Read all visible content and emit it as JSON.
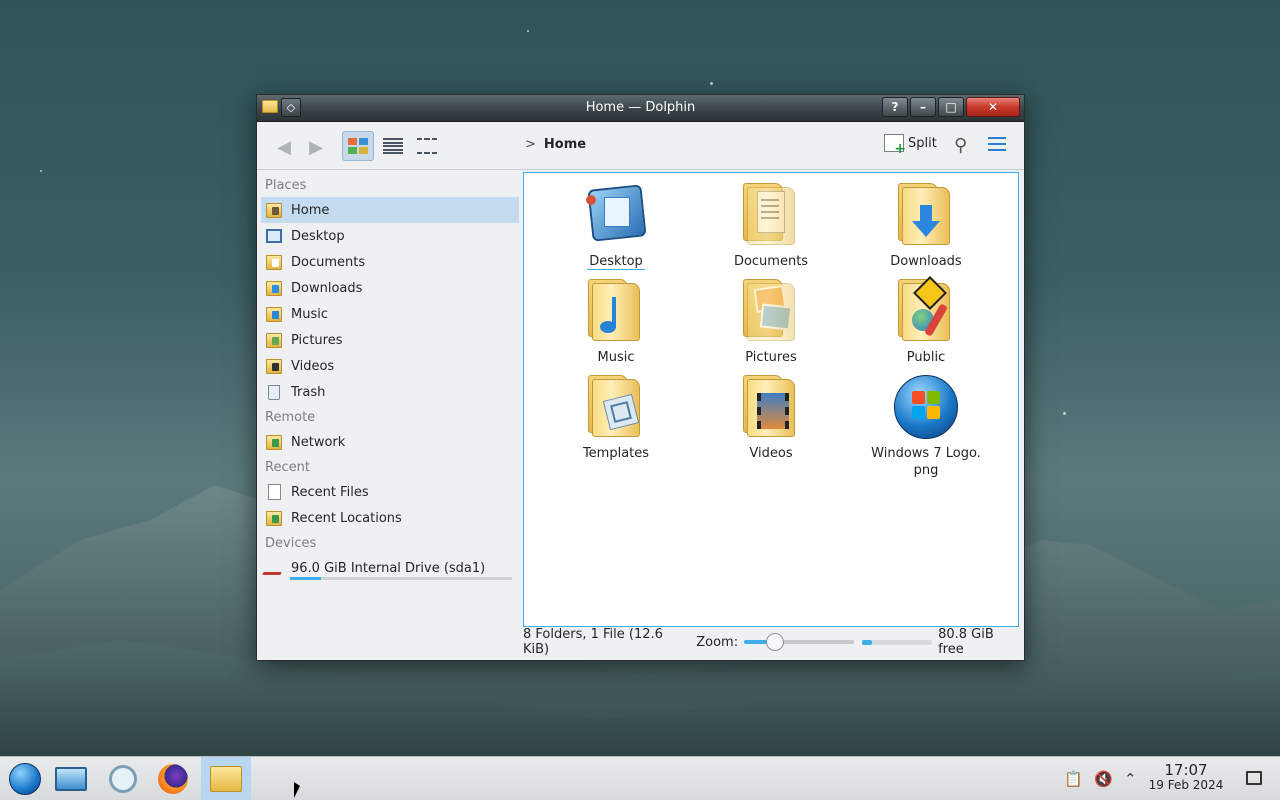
{
  "window": {
    "title": "Home — Dolphin",
    "buttons": {
      "help": "?",
      "minimize": "–",
      "maximize": "□",
      "close": "✕"
    }
  },
  "toolbar": {
    "breadcrumb": "Home",
    "split_label": "Split",
    "icons": [
      "back-arrow-icon",
      "forward-arrow-icon",
      "icons-view-icon",
      "details-view-icon",
      "compact-view-icon",
      "split-icon",
      "search-icon",
      "hamburger-menu-icon"
    ]
  },
  "places": {
    "groups": [
      {
        "title": "Places",
        "items": [
          "Home",
          "Desktop",
          "Documents",
          "Downloads",
          "Music",
          "Pictures",
          "Videos",
          "Trash"
        ]
      },
      {
        "title": "Remote",
        "items": [
          "Network"
        ]
      },
      {
        "title": "Recent",
        "items": [
          "Recent Files",
          "Recent Locations"
        ]
      },
      {
        "title": "Devices",
        "items": [
          "96.0 GiB Internal Drive (sda1)"
        ]
      }
    ],
    "active_item": "Home",
    "drive_usage_fraction": 0.14
  },
  "files": [
    {
      "name": "Desktop",
      "kind": "desktop"
    },
    {
      "name": "Documents",
      "kind": "folder-documents"
    },
    {
      "name": "Downloads",
      "kind": "folder-downloads"
    },
    {
      "name": "Music",
      "kind": "folder-music"
    },
    {
      "name": "Pictures",
      "kind": "folder-pictures"
    },
    {
      "name": "Public",
      "kind": "folder-public"
    },
    {
      "name": "Templates",
      "kind": "folder-templates"
    },
    {
      "name": "Videos",
      "kind": "folder-videos"
    },
    {
      "name": "Windows 7 Logo.",
      "name2": "png",
      "kind": "png-file"
    }
  ],
  "statusbar": {
    "summary": "8 Folders, 1 File (12.6 KiB)",
    "zoom_label": "Zoom:",
    "zoom_fraction": 0.28,
    "free_fraction": 0.14,
    "free_text": "80.8 GiB free"
  },
  "taskbar": {
    "time": "17:07",
    "date": "19 Feb 2024",
    "icons": [
      "start-orb-icon",
      "system-settings-icon",
      "discover-icon",
      "firefox-icon",
      "dolphin-icon",
      "clipboard-icon",
      "muted-volume-icon",
      "tray-expand-icon",
      "show-desktop-icon"
    ]
  },
  "colors": {
    "accent": "#3daee9",
    "selection": "#c5dcf0",
    "close_button": "#c8382a"
  }
}
